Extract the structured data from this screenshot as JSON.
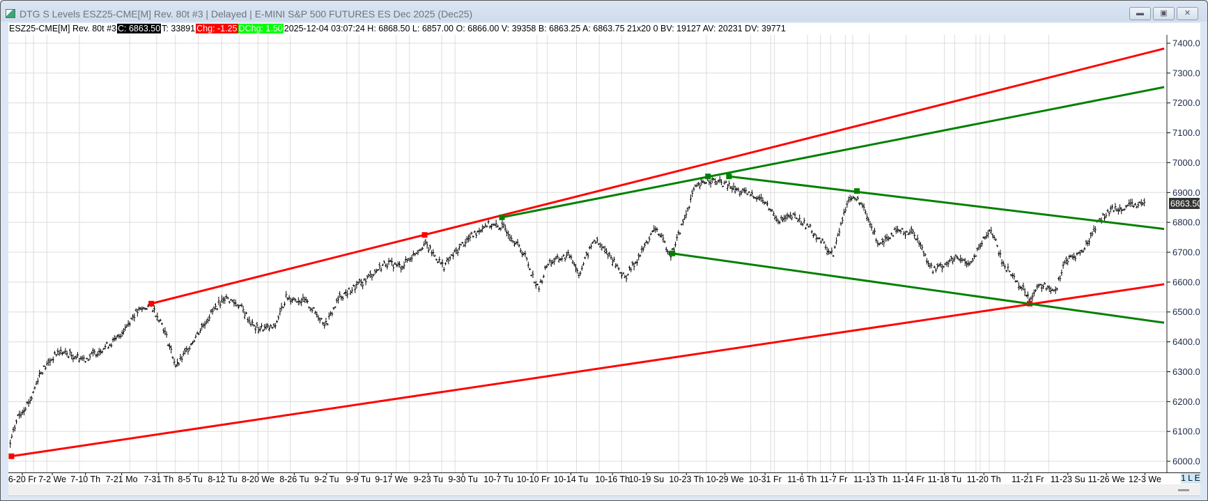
{
  "window": {
    "title": "DTG S Levels ESZ25-CME[M]  Rev. 80t #3 | Delayed | E-MINI S&P 500 FUTURES ES Dec 2025 (Dec25)",
    "minimize_icon": "minimize-icon",
    "maximize_icon": "restore-icon",
    "close_icon": "close-icon"
  },
  "infobar": {
    "symbol": "ESZ25-CME[M]  Rev. 80t #3",
    "close": "C: 6863.50",
    "ticks": "T: 33891",
    "chg": "Chg: -1.25",
    "dchg": "DChg: 1.50",
    "rest": "2025-12-04 03:07:24 H: 6868.50 L: 6857.00 O: 6866.00 V: 39358 B: 6863.25 A: 6863.75 21x20 0 BV: 19127 AV: 20231 DV: 39771",
    "colors": {
      "close_bg": "#000000",
      "chg_bg": "#ff0000",
      "dchg_bg": "#00ff00"
    }
  },
  "legend_tag": "1 L E",
  "chart_data": {
    "type": "bar",
    "ylim": [
      6000,
      7450
    ],
    "yticks": [
      "6000.00",
      "6100.00",
      "6200.00",
      "6300.00",
      "6400.00",
      "6500.00",
      "6600.00",
      "6700.00",
      "6800.00",
      "6900.00",
      "7000.00",
      "7100.00",
      "7200.00",
      "7300.00",
      "7400.00"
    ],
    "xticks": [
      "6-20 Fr",
      "7-2 We",
      "7-10 Th",
      "7-21 Mo",
      "7-31 Th",
      "8-5 Tu",
      "8-12 Tu",
      "8-20 We",
      "8-26 Tu",
      "9-2 Tu",
      "9-9 Tu",
      "9-17 We",
      "9-23 Tu",
      "9-30 Tu",
      "10-7 Tu",
      "10-10 Fr",
      "10-14 Tu",
      "10-16 Th",
      "10-19 Su",
      "10-23 Th",
      "10-29 We",
      "10-31 Fr",
      "11-6 Th",
      "11-7 Fr",
      "11-13 Th",
      "11-14 Fr",
      "11-18 Tu",
      "11-20 Th",
      "11-21 Fr",
      "11-23 Su",
      "11-26 We",
      "12-3 We"
    ],
    "last_price": "6863.50",
    "grid": true,
    "price_path": [
      [
        -0.4,
        6058
      ],
      [
        -0.15,
        6149
      ],
      [
        0.31,
        6213
      ],
      [
        0.56,
        6291
      ],
      [
        1.19,
        6368
      ],
      [
        2.0,
        6342
      ],
      [
        2.85,
        6407
      ],
      [
        3.38,
        6497
      ],
      [
        3.79,
        6523
      ],
      [
        4.12,
        6458
      ],
      [
        4.56,
        6316
      ],
      [
        5.1,
        6407
      ],
      [
        5.57,
        6484
      ],
      [
        6.04,
        6549
      ],
      [
        6.48,
        6523
      ],
      [
        6.91,
        6446
      ],
      [
        7.45,
        6446
      ],
      [
        7.77,
        6549
      ],
      [
        8.33,
        6536
      ],
      [
        8.98,
        6458
      ],
      [
        9.41,
        6549
      ],
      [
        10.14,
        6600
      ],
      [
        10.84,
        6665
      ],
      [
        11.27,
        6652
      ],
      [
        11.9,
        6729
      ],
      [
        12.44,
        6652
      ],
      [
        13.0,
        6729
      ],
      [
        13.65,
        6794
      ],
      [
        14.2,
        6781
      ],
      [
        14.76,
        6691
      ],
      [
        15.14,
        6575
      ],
      [
        15.39,
        6665
      ],
      [
        16.0,
        6691
      ],
      [
        16.19,
        6626
      ],
      [
        16.56,
        6742
      ],
      [
        16.93,
        6691
      ],
      [
        17.36,
        6613
      ],
      [
        17.82,
        6691
      ],
      [
        18.23,
        6781
      ],
      [
        18.62,
        6691
      ],
      [
        18.9,
        6794
      ],
      [
        19.2,
        6910
      ],
      [
        19.56,
        6943
      ],
      [
        20.0,
        6928
      ],
      [
        20.38,
        6902
      ],
      [
        20.87,
        6884
      ],
      [
        21.38,
        6807
      ],
      [
        21.79,
        6820
      ],
      [
        22.24,
        6781
      ],
      [
        22.98,
        6691
      ],
      [
        23.4,
        6884
      ],
      [
        23.71,
        6871
      ],
      [
        24.22,
        6729
      ],
      [
        24.63,
        6768
      ],
      [
        25.15,
        6768
      ],
      [
        25.68,
        6639
      ],
      [
        26.29,
        6678
      ],
      [
        26.69,
        6665
      ],
      [
        27.16,
        6781
      ],
      [
        27.42,
        6665
      ],
      [
        28.04,
        6549
      ],
      [
        28.33,
        6588
      ],
      [
        28.71,
        6575
      ],
      [
        28.9,
        6665
      ],
      [
        29.4,
        6704
      ],
      [
        29.8,
        6807
      ],
      [
        30.2,
        6846
      ],
      [
        31.0,
        6863.5
      ]
    ],
    "trendlines": [
      {
        "color": "#ff0000",
        "from": [
          3.8,
          6528
        ],
        "to": [
          31.5,
          7382
        ],
        "anchors": [
          [
            3.8,
            6528
          ],
          [
            11.9,
            6758
          ]
        ]
      },
      {
        "color": "#ff0000",
        "from": [
          -0.36,
          6017
        ],
        "to": [
          31.5,
          6593
        ],
        "anchors": [
          [
            -0.36,
            6017
          ],
          [
            28.05,
            6528
          ]
        ]
      },
      {
        "color": "#008000",
        "from": [
          14.1,
          6817
        ],
        "to": [
          31.5,
          7253
        ],
        "anchors": [
          [
            14.1,
            6817
          ],
          [
            19.56,
            6954
          ]
        ]
      },
      {
        "color": "#008000",
        "from": [
          20.1,
          6954
        ],
        "to": [
          31.5,
          6778
        ],
        "anchors": [
          [
            20.1,
            6954
          ],
          [
            23.63,
            6905
          ]
        ]
      },
      {
        "color": "#008000",
        "from": [
          18.65,
          6696
        ],
        "to": [
          31.5,
          6464
        ],
        "anchors": [
          [
            18.65,
            6696
          ]
        ]
      }
    ]
  }
}
